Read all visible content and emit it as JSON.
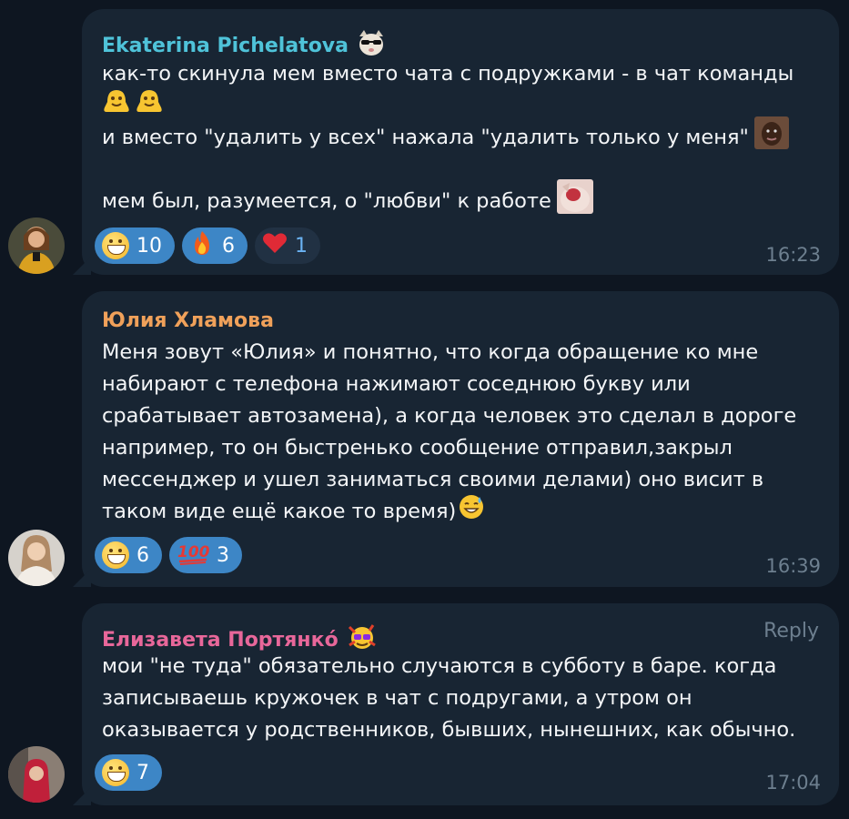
{
  "colors": {
    "background": "#0e1621",
    "bubble": "#182533",
    "reaction_active": "#3d86c6",
    "reaction_inactive": "#213143",
    "time": "#6d7f8f",
    "text": "#f3f5f7"
  },
  "messages": [
    {
      "author": "Ekaterina Pichelatova",
      "author_color": "#4fc3d9",
      "author_badge": "cat-sunglasses-sticker",
      "lines": [
        {
          "text": "как-то скинула мем вместо чата с подружками - в чат команды",
          "emoji": []
        },
        {
          "text": "",
          "emoji": [
            "melting-face-emoji",
            "melting-face-emoji"
          ]
        },
        {
          "text": "и вместо \"удалить у всех\" нажала \"удалить только у меня\"",
          "emoji": [
            "face-sticker"
          ]
        },
        {
          "text": "",
          "emoji": []
        },
        {
          "text": "мем был, разумеется, о \"любви\" к работе",
          "emoji": [
            "cat-sticker"
          ]
        }
      ],
      "reactions": [
        {
          "icon": "grinning-emoji",
          "count": "10",
          "active": true
        },
        {
          "icon": "fire-emoji",
          "count": "6",
          "active": true
        },
        {
          "icon": "heart-emoji",
          "count": "1",
          "active": false
        }
      ],
      "time": "16:23"
    },
    {
      "author": "Юлия Хламова",
      "author_color": "#f0a15a",
      "author_badge": "",
      "lines": [
        {
          "text": "Меня зовут «Юлия» и понятно, что когда обращение ко мне",
          "emoji": []
        },
        {
          "text": "набирают с телефона нажимают соседнюю букву или",
          "emoji": []
        },
        {
          "text": "срабатывает автозамена), а когда человек это сделал в дороге",
          "emoji": []
        },
        {
          "text": "например, то он быстренько сообщение отправил,закрыл",
          "emoji": []
        },
        {
          "text": "мессенджер и ушел заниматься своими делами) оно висит в",
          "emoji": []
        },
        {
          "text": "таком виде ещё какое то время)",
          "emoji": [
            "sweat-smile-emoji"
          ]
        }
      ],
      "reactions": [
        {
          "icon": "grinning-emoji",
          "count": "6",
          "active": true
        },
        {
          "icon": "hundred-points-emoji",
          "count": "3",
          "active": true
        }
      ],
      "time": "16:39"
    },
    {
      "author": "Елизавета Портянко́",
      "author_color": "#e8679a",
      "author_badge": "party-face-sticker",
      "reply_label": "Reply",
      "lines": [
        {
          "text": "мои \"не туда\" обязательно случаются в субботу в баре. когда",
          "emoji": []
        },
        {
          "text": "записываешь кружочек в чат с подругами, а утром он",
          "emoji": []
        },
        {
          "text": "оказывается у родственников, бывших, нынешних, как обычно.",
          "emoji": []
        }
      ],
      "reactions": [
        {
          "icon": "grinning-emoji",
          "count": "7",
          "active": true
        }
      ],
      "time": "17:04"
    }
  ]
}
